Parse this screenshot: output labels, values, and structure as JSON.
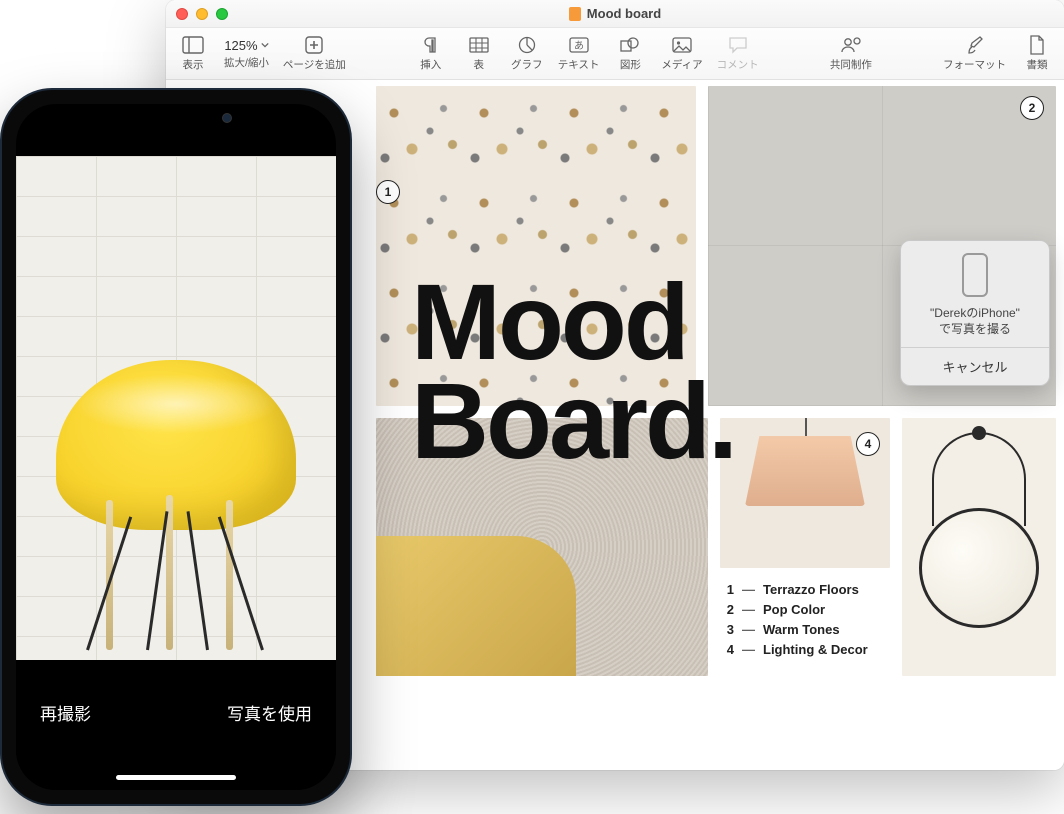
{
  "window": {
    "title": "Mood board"
  },
  "toolbar": {
    "view": "表示",
    "zoom_label": "拡大/縮小",
    "zoom_value": "125%",
    "add_page": "ページを追加",
    "insert": "挿入",
    "table": "表",
    "chart": "グラフ",
    "text": "テキスト",
    "shape": "図形",
    "media": "メディア",
    "comment": "コメント",
    "collaborate": "共同制作",
    "format": "フォーマット",
    "document": "書類"
  },
  "document": {
    "headline_line1": "Mood",
    "headline_line2": "Board."
  },
  "badges": {
    "b1": "1",
    "b2": "2",
    "b4": "4"
  },
  "legend": [
    {
      "num": "1",
      "text": "Terrazzo Floors"
    },
    {
      "num": "2",
      "text": "Pop Color"
    },
    {
      "num": "3",
      "text": "Warm Tones"
    },
    {
      "num": "4",
      "text": "Lighting & Decor"
    }
  ],
  "popover": {
    "line1": "\"DerekのiPhone\"",
    "line2": "で写真を撮る",
    "cancel": "キャンセル"
  },
  "iphone": {
    "retake": "再撮影",
    "use_photo": "写真を使用"
  }
}
